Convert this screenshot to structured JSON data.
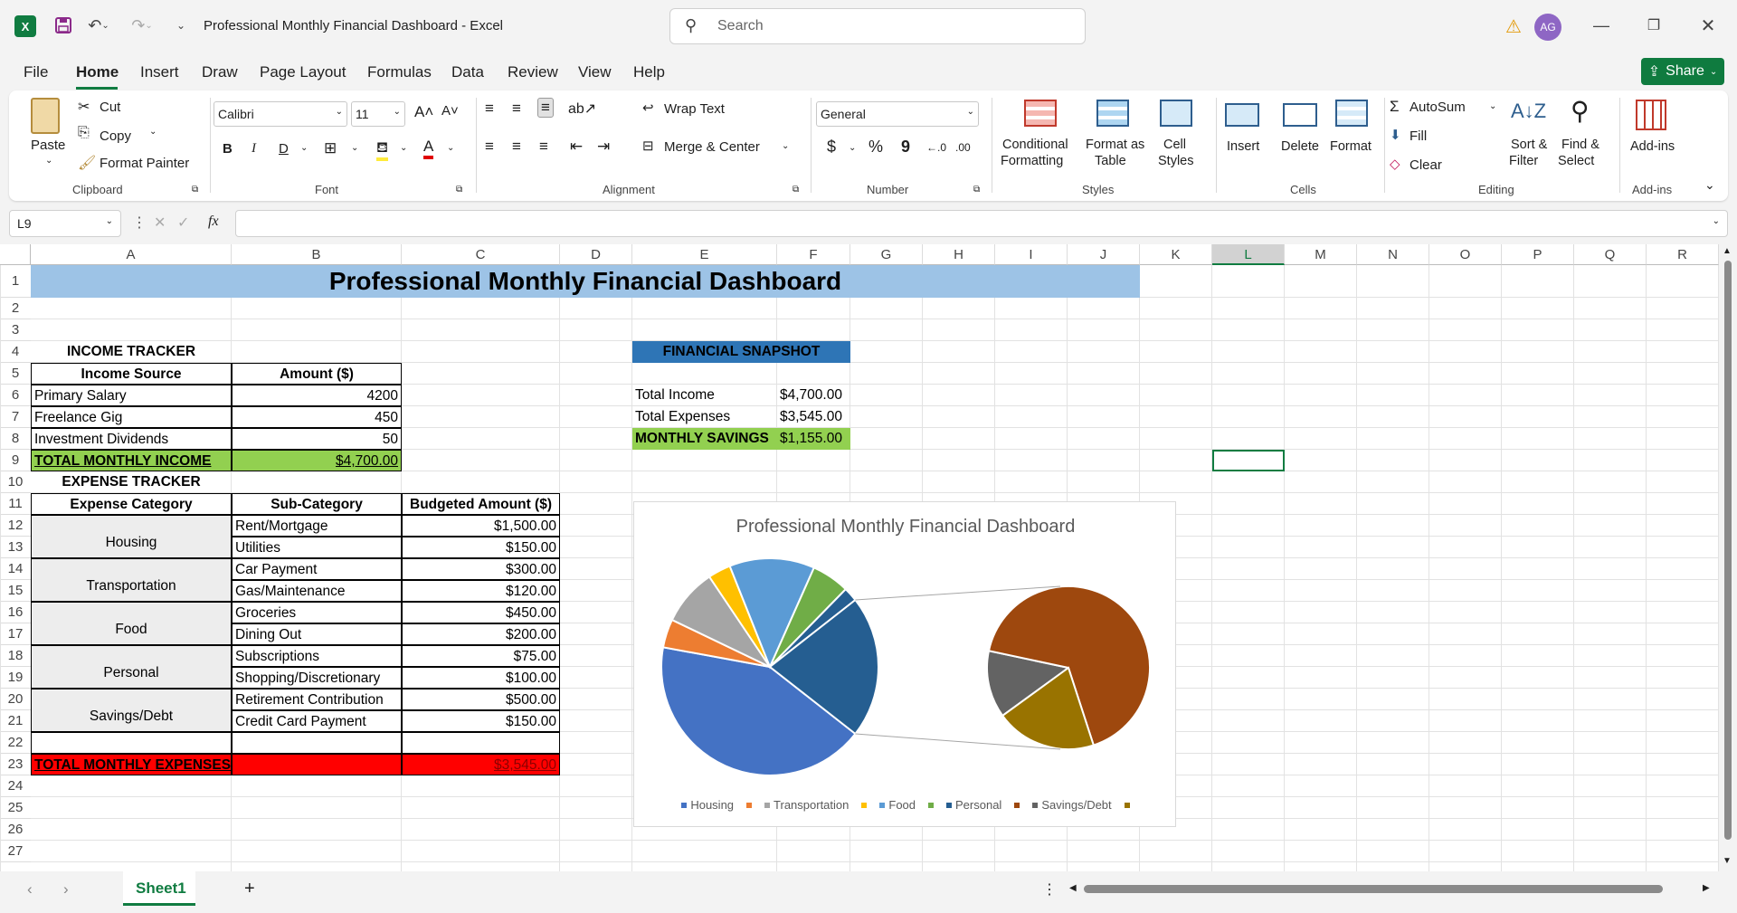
{
  "titlebar": {
    "title": "Professional Monthly Financial Dashboard  -  Excel",
    "search_placeholder": "Search",
    "avatar": "AG"
  },
  "menu": [
    "File",
    "Home",
    "Insert",
    "Draw",
    "Page Layout",
    "Formulas",
    "Data",
    "Review",
    "View",
    "Help"
  ],
  "share_label": "Share",
  "ribbon": {
    "clipboard": {
      "paste": "Paste",
      "cut": "Cut",
      "copy": "Copy",
      "format_painter": "Format Painter",
      "label": "Clipboard"
    },
    "font": {
      "family": "Calibri",
      "size": "11",
      "label": "Font",
      "bold": "B",
      "italic": "I",
      "underline": "D"
    },
    "alignment": {
      "wrap": "Wrap Text",
      "merge": "Merge & Center",
      "label": "Alignment"
    },
    "number": {
      "format": "General",
      "label": "Number",
      "currency": "$",
      "percent": "%",
      "comma": "9"
    },
    "styles": {
      "conditional": "Conditional",
      "conditional2": "Formatting",
      "format_as": "Format as",
      "format_as2": "Table",
      "cell": "Cell",
      "cell2": "Styles",
      "label": "Styles"
    },
    "cells": {
      "insert": "Insert",
      "delete": "Delete",
      "format": "Format",
      "label": "Cells"
    },
    "editing": {
      "autosum": "AutoSum",
      "fill": "Fill",
      "clear": "Clear",
      "sort": "Sort &",
      "sort2": "Filter",
      "find": "Find &",
      "find2": "Select",
      "label": "Editing"
    },
    "addins": {
      "name": "Add-ins",
      "label": "Add-ins"
    }
  },
  "formula_bar": {
    "name_box": "L9",
    "fx": "fx"
  },
  "columns": [
    "A",
    "B",
    "C",
    "D",
    "E",
    "F",
    "G",
    "H",
    "I",
    "J",
    "K",
    "L",
    "M",
    "N",
    "O",
    "P",
    "Q",
    "R"
  ],
  "rows": [
    "1",
    "2",
    "3",
    "4",
    "5",
    "6",
    "7",
    "8",
    "9",
    "10",
    "11",
    "12",
    "13",
    "14",
    "15",
    "16",
    "17",
    "18",
    "19",
    "20",
    "21",
    "22",
    "23",
    "24",
    "25",
    "26",
    "27"
  ],
  "sheet": {
    "title": "Professional Monthly Financial Dashboard",
    "income_tracker": "INCOME TRACKER",
    "income_headers": [
      "Income Source",
      "Amount ($)"
    ],
    "income_rows": [
      [
        "Primary Salary",
        "4200"
      ],
      [
        "Freelance Gig",
        "450"
      ],
      [
        "Investment Dividends",
        "50"
      ]
    ],
    "total_income_label": "TOTAL MONTHLY INCOME",
    "total_income_value": "$4,700.00",
    "expense_tracker": "EXPENSE TRACKER",
    "expense_headers": [
      "Expense Category",
      "Sub-Category",
      "Budgeted Amount ($)"
    ],
    "expense_categories": [
      "Housing",
      "Transportation",
      "Food",
      "Personal",
      "Savings/Debt"
    ],
    "expense_rows": [
      [
        "Rent/Mortgage",
        "$1,500.00"
      ],
      [
        "Utilities",
        "$150.00"
      ],
      [
        "Car Payment",
        "$300.00"
      ],
      [
        "Gas/Maintenance",
        "$120.00"
      ],
      [
        "Groceries",
        "$450.00"
      ],
      [
        "Dining Out",
        "$200.00"
      ],
      [
        "Subscriptions",
        "$75.00"
      ],
      [
        "Shopping/Discretionary",
        "$100.00"
      ],
      [
        "Retirement Contribution",
        "$500.00"
      ],
      [
        "Credit Card Payment",
        "$150.00"
      ]
    ],
    "total_expenses_label": "TOTAL MONTHLY EXPENSES",
    "total_expenses_value": "$3,545.00",
    "snapshot_title": "FINANCIAL SNAPSHOT",
    "snapshot_rows": [
      [
        "Total Income",
        "$4,700.00"
      ],
      [
        "Total Expenses",
        "$3,545.00"
      ]
    ],
    "savings_label": "MONTHLY SAVINGS",
    "savings_value": "$1,155.00"
  },
  "chart_data": {
    "type": "pie",
    "title": "Professional Monthly Financial Dashboard",
    "categories": [
      "Rent/Mortgage",
      "Utilities",
      "Car Payment",
      "Gas/Maintenance",
      "Groceries",
      "Dining Out",
      "Subscriptions",
      "Shopping/Discretionary",
      "Retirement Contribution",
      "Credit Card Payment"
    ],
    "values": [
      1500,
      150,
      300,
      120,
      450,
      200,
      75,
      100,
      500,
      150
    ],
    "legend": [
      "Housing",
      "Transportation",
      "Food",
      "Personal",
      "Savings/Debt"
    ],
    "legend_placement": "bottom",
    "colors": [
      "#4472c4",
      "#ed7d31",
      "#a5a5a5",
      "#ffc000",
      "#5b9bd5",
      "#70ad47",
      "#255e91",
      "#636363",
      "#9e480e",
      "#997300"
    ]
  },
  "sheet_tab": "Sheet1"
}
